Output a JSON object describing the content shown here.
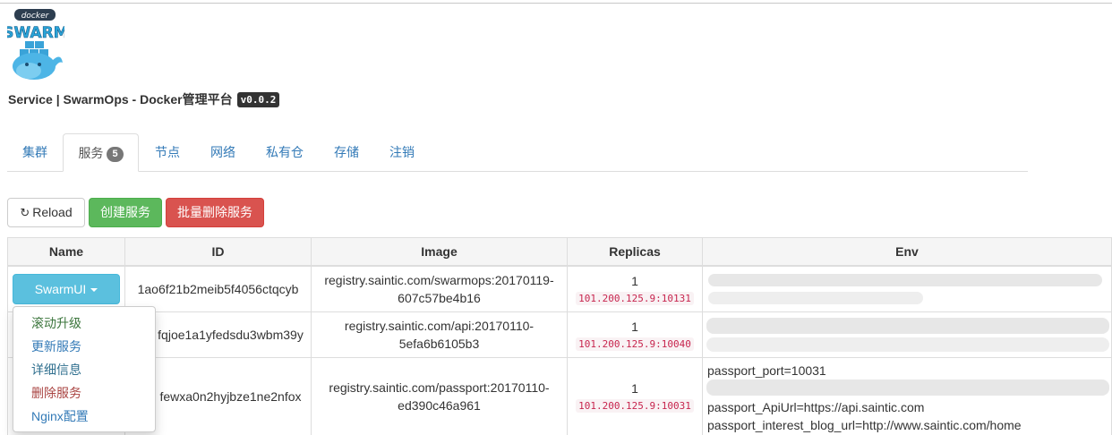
{
  "header": {
    "logo_text": "docker SWARM",
    "title": "Service | SwarmOps - Docker管理平台",
    "version": "v0.0.2"
  },
  "tabs": [
    {
      "label": "集群"
    },
    {
      "label": "服务",
      "badge": "5",
      "active": true
    },
    {
      "label": "节点"
    },
    {
      "label": "网络"
    },
    {
      "label": "私有仓"
    },
    {
      "label": "存储"
    },
    {
      "label": "注销"
    }
  ],
  "toolbar": {
    "reload_label": "Reload",
    "create_label": "创建服务",
    "batch_delete_label": "批量删除服务"
  },
  "table": {
    "columns": [
      "Name",
      "ID",
      "Image",
      "Replicas",
      "Env"
    ],
    "rows": [
      {
        "name": "SwarmUI",
        "id": "1ao6f21b2meib5f4056ctqcyb",
        "image_line1": "registry.saintic.com/swarmops:20170119-",
        "image_line2": "607c57be4b16",
        "replicas": "1",
        "port": "101.200.125.9:10131"
      },
      {
        "id": "fqjoe1a1yfedsdu3wbm39y",
        "image_line1": "registry.saintic.com/api:20170110-",
        "image_line2": "5efa6b6105b3",
        "replicas": "1",
        "port": "101.200.125.9:10040"
      },
      {
        "id": "fewxa0n2hyjbze1ne2nfox",
        "image_line1": "registry.saintic.com/passport:20170110-",
        "image_line2": "ed390c46a961",
        "replicas": "1",
        "port": "101.200.125.9:10031",
        "env": [
          "passport_port=10031",
          "passport_ApiUrl=https://api.saintic.com",
          "passport_interest_blog_url=http://www.saintic.com/home"
        ]
      }
    ]
  },
  "dropdown_menu": {
    "items": [
      "滚动升级",
      "更新服务",
      "详细信息",
      "删除服务",
      "Nginx配置"
    ]
  },
  "colors": {
    "info": "#5bc0de",
    "success": "#5cb85c",
    "danger": "#d9534f",
    "link": "#337ab7"
  }
}
